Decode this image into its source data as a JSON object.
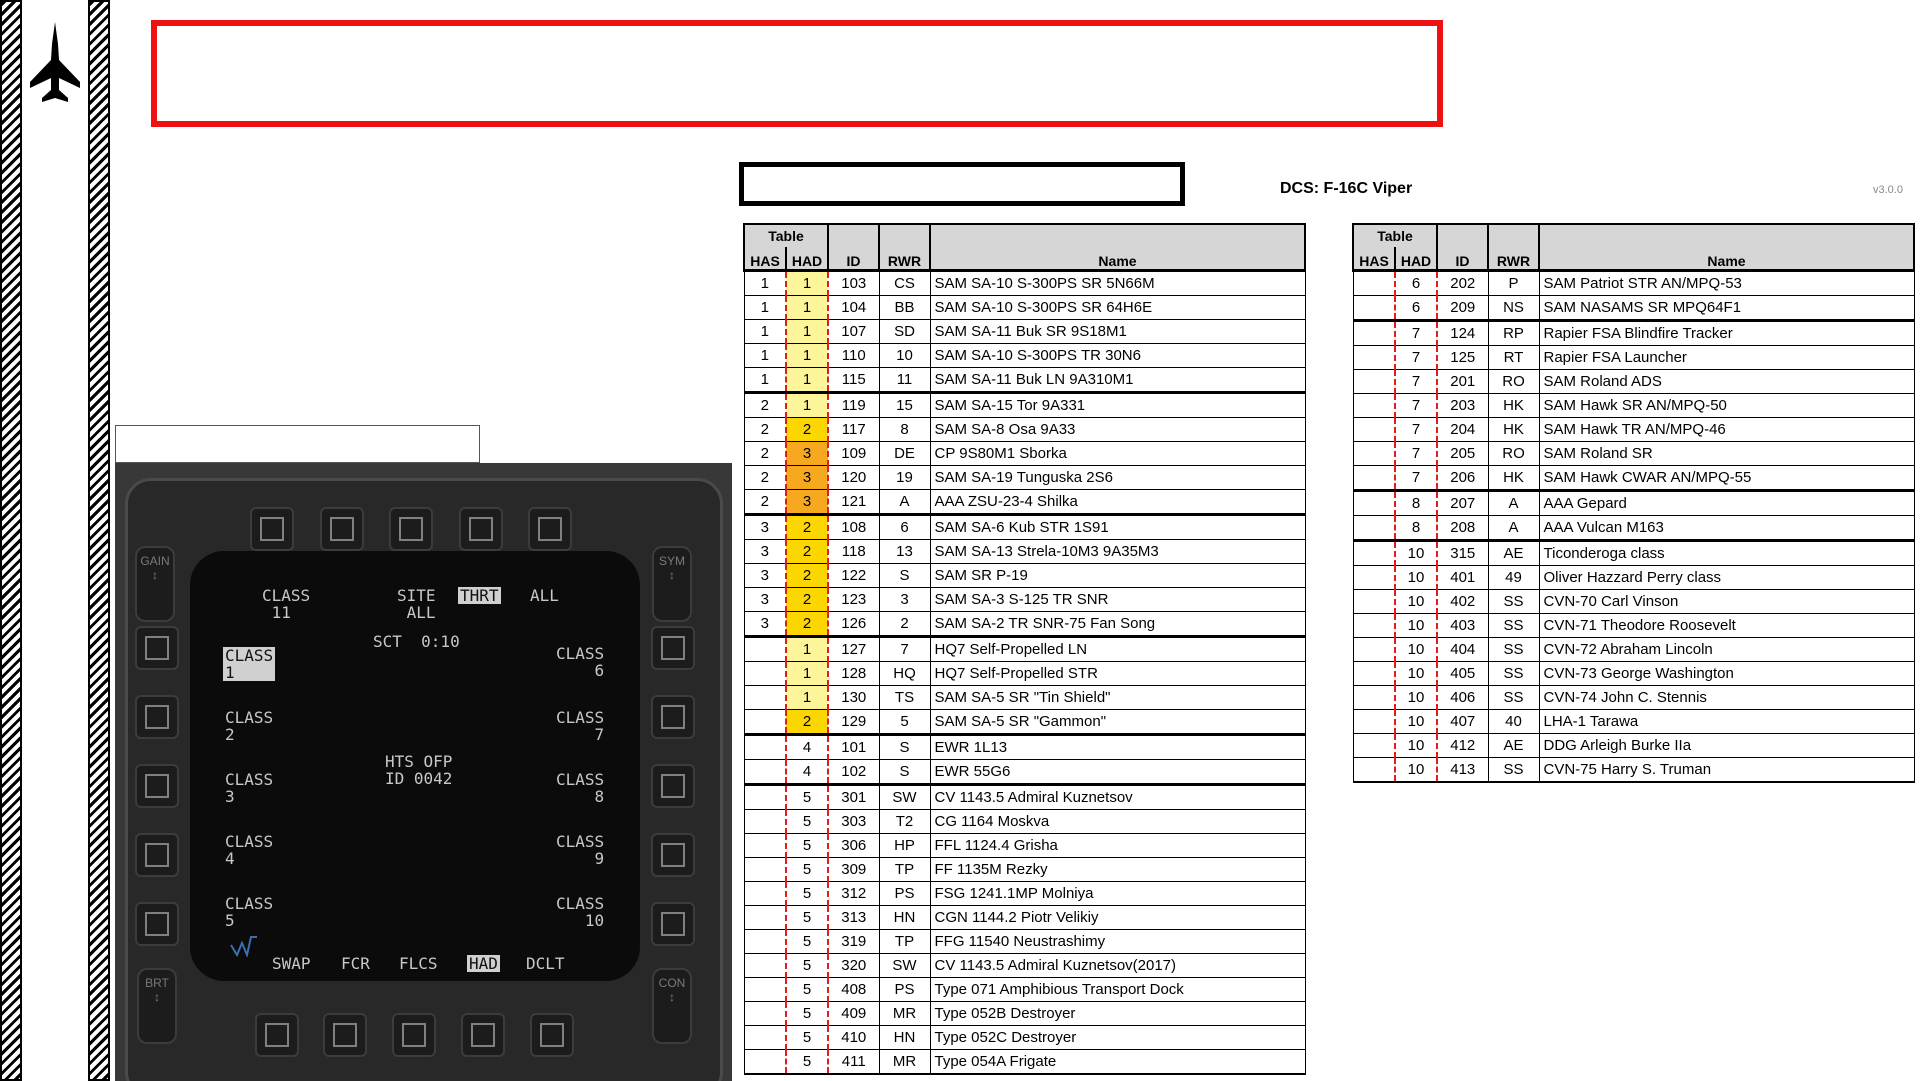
{
  "app": {
    "title": "DCS: F-16C Viper",
    "version": "v3.0.0"
  },
  "mfd": {
    "side_labels": {
      "gain": "GAIN",
      "sym": "SYM",
      "brt": "BRT",
      "con": "CON"
    },
    "class_top": "CLASS\n 11",
    "modes": {
      "site": "SITE\n ALL",
      "thrt": "THRT",
      "all": "ALL"
    },
    "sct": "SCT  0:10",
    "classes_left": [
      "CLASS\n1",
      "CLASS\n2",
      "CLASS\n3",
      "CLASS\n4",
      "CLASS\n5"
    ],
    "classes_right": [
      "CLASS\n    6",
      "CLASS\n    7",
      "CLASS\n    8",
      "CLASS\n    9",
      "CLASS\n   10"
    ],
    "center": "HTS OFP\nID 0042",
    "bottom": {
      "swap": "SWAP",
      "fcr": "FCR",
      "flcs": "FLCS",
      "had": "HAD",
      "dclt": "DCLT"
    }
  },
  "table_headers": {
    "group": "Table",
    "has": "HAS",
    "had": "HAD",
    "id": "ID",
    "rwr": "RWR",
    "name": "Name"
  },
  "colors": {
    "banner_red": "#ee1111",
    "had_yellow": "#fdf59a",
    "had_amber": "#fbd600",
    "had_orange": "#f6a81e",
    "dash_red": "#e21b1b"
  },
  "table1": [
    {
      "has": "1",
      "had": "1",
      "id": "103",
      "rwr": "CS",
      "name": "SAM SA-10 S-300PS SR 5N66M",
      "color": "yellow",
      "group": true
    },
    {
      "has": "1",
      "had": "1",
      "id": "104",
      "rwr": "BB",
      "name": "SAM SA-10 S-300PS SR 64H6E",
      "color": "yellow"
    },
    {
      "has": "1",
      "had": "1",
      "id": "107",
      "rwr": "SD",
      "name": "SAM SA-11 Buk SR 9S18M1",
      "color": "yellow"
    },
    {
      "has": "1",
      "had": "1",
      "id": "110",
      "rwr": "10",
      "name": "SAM SA-10 S-300PS TR 30N6",
      "color": "yellow"
    },
    {
      "has": "1",
      "had": "1",
      "id": "115",
      "rwr": "11",
      "name": "SAM SA-11 Buk LN 9A310M1",
      "color": "yellow"
    },
    {
      "has": "2",
      "had": "1",
      "id": "119",
      "rwr": "15",
      "name": "SAM SA-15 Tor 9A331",
      "color": "yellow",
      "group": true
    },
    {
      "has": "2",
      "had": "2",
      "id": "117",
      "rwr": "8",
      "name": "SAM SA-8 Osa 9A33",
      "color": "amber"
    },
    {
      "has": "2",
      "had": "3",
      "id": "109",
      "rwr": "DE",
      "name": "CP 9S80M1 Sborka",
      "color": "orange"
    },
    {
      "has": "2",
      "had": "3",
      "id": "120",
      "rwr": "19",
      "name": "SAM SA-19 Tunguska 2S6",
      "color": "orange"
    },
    {
      "has": "2",
      "had": "3",
      "id": "121",
      "rwr": "A",
      "name": "AAA ZSU-23-4 Shilka",
      "color": "orange"
    },
    {
      "has": "3",
      "had": "2",
      "id": "108",
      "rwr": "6",
      "name": "SAM SA-6 Kub STR 1S91",
      "color": "amber",
      "group": true
    },
    {
      "has": "3",
      "had": "2",
      "id": "118",
      "rwr": "13",
      "name": "SAM SA-13 Strela-10M3 9A35M3",
      "color": "amber"
    },
    {
      "has": "3",
      "had": "2",
      "id": "122",
      "rwr": "S",
      "name": "SAM SR P-19",
      "color": "amber"
    },
    {
      "has": "3",
      "had": "2",
      "id": "123",
      "rwr": "3",
      "name": "SAM SA-3 S-125 TR SNR",
      "color": "amber"
    },
    {
      "has": "3",
      "had": "2",
      "id": "126",
      "rwr": "2",
      "name": "SAM SA-2 TR SNR-75 Fan Song",
      "color": "amber"
    },
    {
      "has": "",
      "had": "1",
      "id": "127",
      "rwr": "7",
      "name": "HQ7 Self-Propelled LN",
      "color": "yellow",
      "group": true
    },
    {
      "has": "",
      "had": "1",
      "id": "128",
      "rwr": "HQ",
      "name": "HQ7 Self-Propelled STR",
      "color": "yellow"
    },
    {
      "has": "",
      "had": "1",
      "id": "130",
      "rwr": "TS",
      "name": "SAM SA-5 SR \"Tin Shield\"",
      "color": "yellow"
    },
    {
      "has": "",
      "had": "2",
      "id": "129",
      "rwr": "5",
      "name": "SAM SA-5 SR \"Gammon\"",
      "color": "amber"
    },
    {
      "has": "",
      "had": "4",
      "id": "101",
      "rwr": "S",
      "name": "EWR 1L13",
      "color": "",
      "group": true
    },
    {
      "has": "",
      "had": "4",
      "id": "102",
      "rwr": "S",
      "name": "EWR 55G6",
      "color": ""
    },
    {
      "has": "",
      "had": "5",
      "id": "301",
      "rwr": "SW",
      "name": "CV 1143.5 Admiral Kuznetsov",
      "color": "",
      "group": true
    },
    {
      "has": "",
      "had": "5",
      "id": "303",
      "rwr": "T2",
      "name": "CG 1164 Moskva",
      "color": ""
    },
    {
      "has": "",
      "had": "5",
      "id": "306",
      "rwr": "HP",
      "name": "FFL 1124.4 Grisha",
      "color": ""
    },
    {
      "has": "",
      "had": "5",
      "id": "309",
      "rwr": "TP",
      "name": "FF 1135M Rezky",
      "color": ""
    },
    {
      "has": "",
      "had": "5",
      "id": "312",
      "rwr": "PS",
      "name": "FSG 1241.1MP Molniya",
      "color": ""
    },
    {
      "has": "",
      "had": "5",
      "id": "313",
      "rwr": "HN",
      "name": "CGN 1144.2 Piotr Velikiy",
      "color": ""
    },
    {
      "has": "",
      "had": "5",
      "id": "319",
      "rwr": "TP",
      "name": "FFG 11540 Neustrashimy",
      "color": ""
    },
    {
      "has": "",
      "had": "5",
      "id": "320",
      "rwr": "SW",
      "name": "CV 1143.5 Admiral Kuznetsov(2017)",
      "color": ""
    },
    {
      "has": "",
      "had": "5",
      "id": "408",
      "rwr": "PS",
      "name": "Type 071 Amphibious Transport Dock",
      "color": ""
    },
    {
      "has": "",
      "had": "5",
      "id": "409",
      "rwr": "MR",
      "name": "Type 052B Destroyer",
      "color": ""
    },
    {
      "has": "",
      "had": "5",
      "id": "410",
      "rwr": "HN",
      "name": "Type 052C Destroyer",
      "color": ""
    },
    {
      "has": "",
      "had": "5",
      "id": "411",
      "rwr": "MR",
      "name": "Type 054A Frigate",
      "color": ""
    }
  ],
  "table2": [
    {
      "has": "",
      "had": "6",
      "id": "202",
      "rwr": "P",
      "name": "SAM Patriot STR AN/MPQ-53",
      "color": "",
      "group": true
    },
    {
      "has": "",
      "had": "6",
      "id": "209",
      "rwr": "NS",
      "name": "SAM NASAMS SR MPQ64F1",
      "color": ""
    },
    {
      "has": "",
      "had": "7",
      "id": "124",
      "rwr": "RP",
      "name": "Rapier FSA Blindfire Tracker",
      "color": "",
      "group": true
    },
    {
      "has": "",
      "had": "7",
      "id": "125",
      "rwr": "RT",
      "name": "Rapier FSA Launcher",
      "color": ""
    },
    {
      "has": "",
      "had": "7",
      "id": "201",
      "rwr": "RO",
      "name": "SAM Roland ADS",
      "color": ""
    },
    {
      "has": "",
      "had": "7",
      "id": "203",
      "rwr": "HK",
      "name": "SAM Hawk SR AN/MPQ-50",
      "color": ""
    },
    {
      "has": "",
      "had": "7",
      "id": "204",
      "rwr": "HK",
      "name": "SAM Hawk TR AN/MPQ-46",
      "color": ""
    },
    {
      "has": "",
      "had": "7",
      "id": "205",
      "rwr": "RO",
      "name": "SAM Roland SR",
      "color": ""
    },
    {
      "has": "",
      "had": "7",
      "id": "206",
      "rwr": "HK",
      "name": "SAM Hawk CWAR AN/MPQ-55",
      "color": ""
    },
    {
      "has": "",
      "had": "8",
      "id": "207",
      "rwr": "A",
      "name": "AAA Gepard",
      "color": "",
      "group": true
    },
    {
      "has": "",
      "had": "8",
      "id": "208",
      "rwr": "A",
      "name": "AAA Vulcan M163",
      "color": ""
    },
    {
      "has": "",
      "had": "10",
      "id": "315",
      "rwr": "AE",
      "name": "Ticonderoga class",
      "color": "",
      "group": true
    },
    {
      "has": "",
      "had": "10",
      "id": "401",
      "rwr": "49",
      "name": "Oliver Hazzard Perry class",
      "color": ""
    },
    {
      "has": "",
      "had": "10",
      "id": "402",
      "rwr": "SS",
      "name": "CVN-70 Carl Vinson",
      "color": ""
    },
    {
      "has": "",
      "had": "10",
      "id": "403",
      "rwr": "SS",
      "name": "CVN-71 Theodore Roosevelt",
      "color": ""
    },
    {
      "has": "",
      "had": "10",
      "id": "404",
      "rwr": "SS",
      "name": "CVN-72 Abraham Lincoln",
      "color": ""
    },
    {
      "has": "",
      "had": "10",
      "id": "405",
      "rwr": "SS",
      "name": "CVN-73 George Washington",
      "color": ""
    },
    {
      "has": "",
      "had": "10",
      "id": "406",
      "rwr": "SS",
      "name": "CVN-74 John C. Stennis",
      "color": ""
    },
    {
      "has": "",
      "had": "10",
      "id": "407",
      "rwr": "40",
      "name": "LHA-1 Tarawa",
      "color": ""
    },
    {
      "has": "",
      "had": "10",
      "id": "412",
      "rwr": "AE",
      "name": "DDG Arleigh Burke IIa",
      "color": ""
    },
    {
      "has": "",
      "had": "10",
      "id": "413",
      "rwr": "SS",
      "name": "CVN-75 Harry S. Truman",
      "color": ""
    }
  ]
}
